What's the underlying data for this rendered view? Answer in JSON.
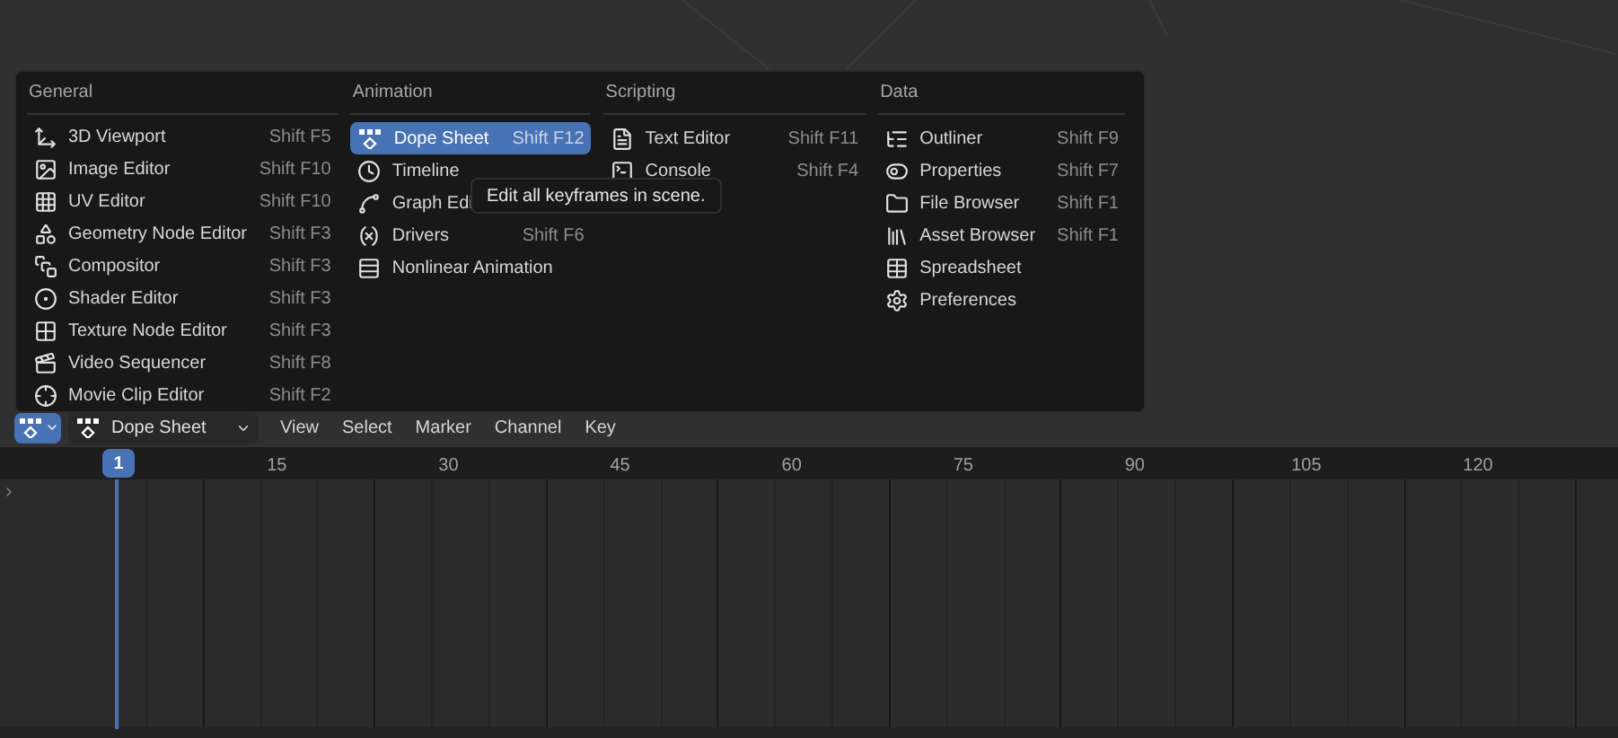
{
  "menu": {
    "columns": [
      {
        "title": "General",
        "items": [
          {
            "label": "3D Viewport",
            "shortcut": "Shift F5",
            "selected": false
          },
          {
            "label": "Image Editor",
            "shortcut": "Shift F10",
            "selected": false
          },
          {
            "label": "UV Editor",
            "shortcut": "Shift F10",
            "selected": false
          },
          {
            "label": "Geometry Node Editor",
            "shortcut": "Shift F3",
            "selected": false
          },
          {
            "label": "Compositor",
            "shortcut": "Shift F3",
            "selected": false
          },
          {
            "label": "Shader Editor",
            "shortcut": "Shift F3",
            "selected": false
          },
          {
            "label": "Texture Node Editor",
            "shortcut": "Shift F3",
            "selected": false
          },
          {
            "label": "Video Sequencer",
            "shortcut": "Shift F8",
            "selected": false
          },
          {
            "label": "Movie Clip Editor",
            "shortcut": "Shift F2",
            "selected": false
          }
        ]
      },
      {
        "title": "Animation",
        "items": [
          {
            "label": "Dope Sheet",
            "shortcut": "Shift F12",
            "selected": true
          },
          {
            "label": "Timeline",
            "selected": false
          },
          {
            "label": "Graph Edi",
            "selected": false
          },
          {
            "label": "Drivers",
            "shortcut": "Shift F6",
            "selected": false
          },
          {
            "label": "Nonlinear Animation",
            "selected": false
          }
        ]
      },
      {
        "title": "Scripting",
        "items": [
          {
            "label": "Text Editor",
            "shortcut": "Shift F11",
            "selected": false
          },
          {
            "label": "Console",
            "shortcut": "Shift F4",
            "selected": false
          }
        ]
      },
      {
        "title": "Data",
        "items": [
          {
            "label": "Outliner",
            "shortcut": "Shift F9",
            "selected": false
          },
          {
            "label": "Properties",
            "shortcut": "Shift F7",
            "selected": false
          },
          {
            "label": "File Browser",
            "shortcut": "Shift F1",
            "selected": false
          },
          {
            "label": "Asset Browser",
            "shortcut": "Shift F1",
            "selected": false
          },
          {
            "label": "Spreadsheet",
            "selected": false
          },
          {
            "label": "Preferences",
            "selected": false
          }
        ]
      }
    ]
  },
  "tooltip": "Edit all keyframes in scene.",
  "header": {
    "editor_type": "Dope Sheet",
    "menus": [
      "View",
      "Select",
      "Marker",
      "Channel",
      "Key"
    ]
  },
  "timeline": {
    "current_frame": "1",
    "frame_labels": [
      "15",
      "30",
      "45",
      "60",
      "75",
      "90",
      "105",
      "120"
    ]
  }
}
